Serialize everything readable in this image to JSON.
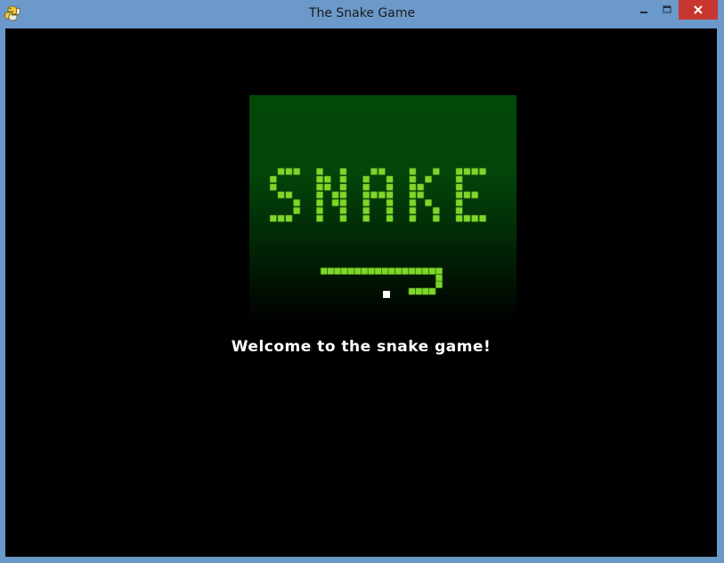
{
  "window": {
    "title": "The Snake Game",
    "icon": "python-icon",
    "controls": [
      "minimize-icon",
      "maximize-icon",
      "close-icon"
    ]
  },
  "splash": {
    "logo_text": "SNAKE",
    "logo_color": "#7ed62a",
    "panel_top_color": "#024807",
    "food_color": "#ffffff"
  },
  "message": "Welcome to the snake game!"
}
